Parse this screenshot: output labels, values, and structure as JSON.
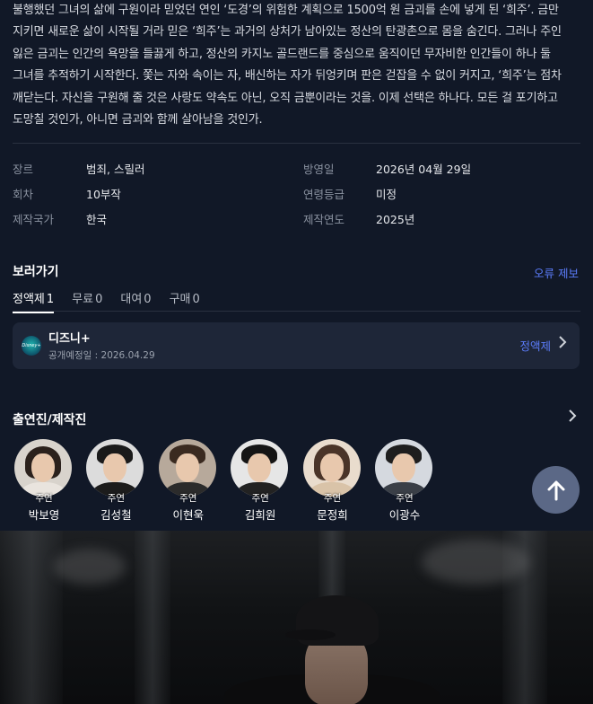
{
  "synopsis": "불행했던 그녀의 삶에 구원이라 믿었던 연인 ‘도경’의 위험한 계획으로 1500억 원 금괴를 손에 넣게 된 ‘희주’. 금만 지키면 새로운 삶이 시작될 거라 믿은 ‘희주’는 과거의 상처가 남아있는 정산의 탄광촌으로 몸을 숨긴다. 그러나 주인 잃은 금괴는 인간의 욕망을 들끓게 하고, 정산의 카지노 골드랜드를 중심으로 움직이던 무자비한 인간들이 하나 둘 그녀를 추적하기 시작한다. 쫓는 자와 속이는 자, 배신하는 자가 뒤엉키며 판은 걷잡을 수 없이 커지고, ‘희주’는 점차 깨닫는다. 자신을 구원해 줄 것은 사랑도 약속도 아닌, 오직 금뿐이라는 것을. 이제 선택은 하나다. 모든 걸 포기하고 도망칠 것인가, 아니면 금괴와 함께 살아남을 것인가.",
  "info": {
    "genre_label": "장르",
    "genre_value": "범죄, 스릴러",
    "episodes_label": "회차",
    "episodes_value": "10부작",
    "country_label": "제작국가",
    "country_value": "한국",
    "airdate_label": "방영일",
    "airdate_value": "2026년 04월 29일",
    "rating_label": "연령등급",
    "rating_value": "미정",
    "year_label": "제작연도",
    "year_value": "2025년"
  },
  "watch": {
    "title": "보러가기",
    "report_link": "오류 제보",
    "tabs": [
      {
        "label": "정액제",
        "count": "1"
      },
      {
        "label": "무료",
        "count": "0"
      },
      {
        "label": "대여",
        "count": "0"
      },
      {
        "label": "구매",
        "count": "0"
      }
    ],
    "service": {
      "logo_text": "Disney+",
      "name": "디즈니+",
      "release": "공개예정일 : 2026.04.29",
      "plan": "정액제"
    }
  },
  "cast": {
    "title": "출연진/제작진",
    "items": [
      {
        "role": "주연",
        "name": "박보영"
      },
      {
        "role": "주연",
        "name": "김성철"
      },
      {
        "role": "주연",
        "name": "이현욱"
      },
      {
        "role": "주연",
        "name": "김희원"
      },
      {
        "role": "주연",
        "name": "문정희"
      },
      {
        "role": "주연",
        "name": "이광수"
      }
    ]
  },
  "icons": {
    "chevron": "chevron-right-icon",
    "scroll_top": "arrow-up-icon"
  },
  "colors": {
    "background": "#111827",
    "accent": "#5b7cfa",
    "card": "#1e2638"
  }
}
